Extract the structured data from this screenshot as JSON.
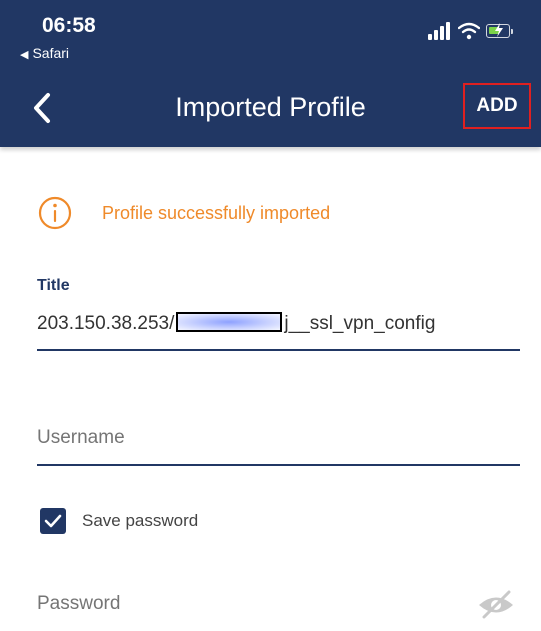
{
  "status_bar": {
    "time": "06:58",
    "back_app": "Safari",
    "icons": [
      "cellular-signal-icon",
      "wifi-icon",
      "battery-charging-icon"
    ]
  },
  "nav": {
    "back_icon": "chevron-left-icon",
    "title": "Imported Profile",
    "add_label": "ADD"
  },
  "notice": {
    "icon": "info-circle-icon",
    "text": "Profile successfully imported",
    "color": "#ef8a2a"
  },
  "fields": {
    "title_label": "Title",
    "title_prefix": "203.150.38.253/",
    "title_suffix": "j__ssl_vpn_config",
    "username_placeholder": "Username",
    "save_password_label": "Save password",
    "save_password_checked": true,
    "password_placeholder": "Password",
    "password_visibility_icon": "eye-slash-icon"
  },
  "colors": {
    "header_bg": "#213764",
    "accent": "#213764",
    "highlight_border": "#e02020"
  }
}
